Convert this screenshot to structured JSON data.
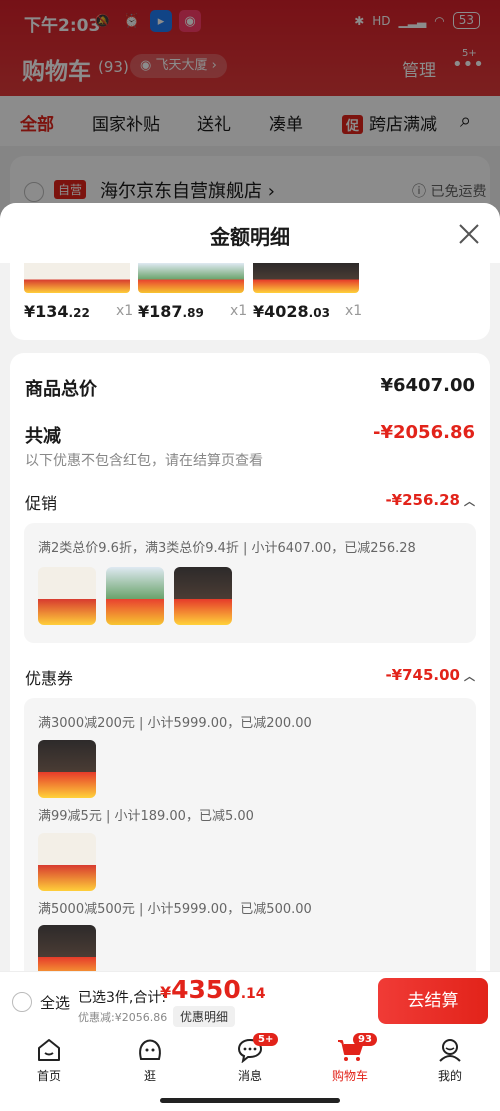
{
  "status_bar": {
    "time": "下午2:03",
    "network": "HD",
    "battery": "53"
  },
  "header": {
    "title": "购物车",
    "count": "(93)",
    "address": "飞天大厦",
    "manage": "管理",
    "more_badge": "5+"
  },
  "tabs": [
    {
      "label": "全部"
    },
    {
      "label": "国家补贴"
    },
    {
      "label": "送礼"
    },
    {
      "label": "凑单"
    },
    {
      "label": "跨店满减",
      "tag": "促"
    }
  ],
  "store": {
    "tag": "自营",
    "name": "海尔京东自营旗舰店",
    "shipping": "已免运费"
  },
  "sheet": {
    "title": "金额明细",
    "products": [
      {
        "price_main": "¥134",
        "price_dec": ".22",
        "qty": "x1"
      },
      {
        "price_main": "¥187",
        "price_dec": ".89",
        "qty": "x1"
      },
      {
        "price_main": "¥4028",
        "price_dec": ".03",
        "qty": "x1"
      }
    ],
    "total_label": "商品总价",
    "total_value": "¥6407.00",
    "discount_label": "共减",
    "discount_value": "-¥2056.86",
    "discount_note": "以下优惠不包含红包，请在结算页查看",
    "promo": {
      "label": "促销",
      "value": "-¥256.28",
      "detail": "满2类总价9.6折，满3类总价9.4折 | 小计6407.00，已减256.28"
    },
    "coupon": {
      "label": "优惠券",
      "value": "-¥745.00",
      "lines": [
        "满3000减200元 | 小计5999.00，已减200.00",
        "满99减5元 | 小计189.00，已减5.00",
        "满5000减500元 | 小计5999.00，已减500.00"
      ]
    }
  },
  "footer": {
    "select_all": "全选",
    "selected_text": "已选3件,合计:",
    "total_yen": "¥",
    "total_int": "4350",
    "total_dec": ".14",
    "saving": "优惠减:¥2056.86",
    "detail_link": "优惠明细",
    "checkout": "去结算"
  },
  "nav": [
    {
      "label": "首页",
      "icon": "home-icon"
    },
    {
      "label": "逛",
      "icon": "browse-icon"
    },
    {
      "label": "消息",
      "icon": "message-icon",
      "badge": "5+"
    },
    {
      "label": "购物车",
      "icon": "cart-icon",
      "badge": "93"
    },
    {
      "label": "我的",
      "icon": "profile-icon"
    }
  ],
  "colors": {
    "brand_red": "#e2231a",
    "header_red": "#d8202a"
  }
}
